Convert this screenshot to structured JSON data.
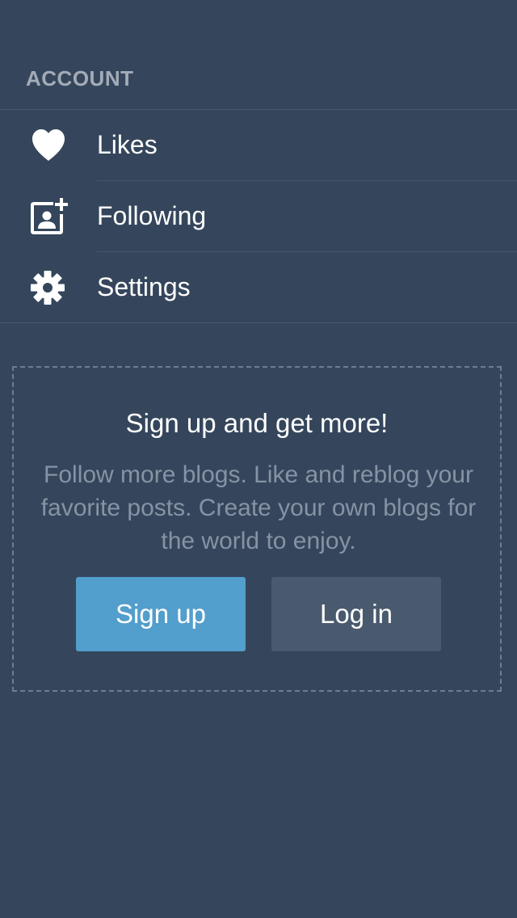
{
  "account": {
    "header": "ACCOUNT",
    "items": [
      {
        "label": "Likes",
        "icon": "heart-icon"
      },
      {
        "label": "Following",
        "icon": "following-icon"
      },
      {
        "label": "Settings",
        "icon": "gear-icon"
      }
    ]
  },
  "promo": {
    "title": "Sign up and get more!",
    "body": "Follow more blogs. Like and reblog your favorite posts. Create your own blogs for the world to enjoy.",
    "signup_label": "Sign up",
    "login_label": "Log in"
  },
  "colors": {
    "background": "#35465c",
    "signup_button": "#529ecc",
    "login_button": "#4a5a6e",
    "header_text": "#a3abb7",
    "body_text": "#8693a4"
  }
}
